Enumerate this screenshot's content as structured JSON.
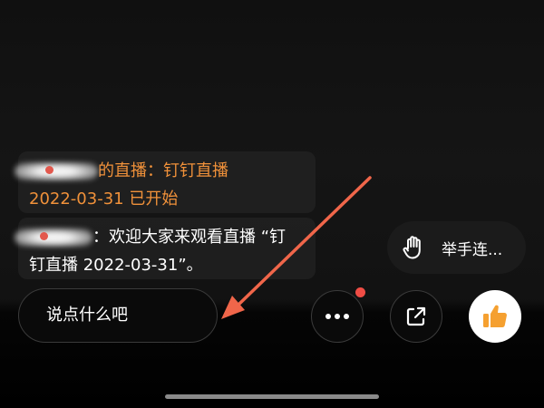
{
  "chat": {
    "system_message": {
      "line1_suffix": "的直播：钉钉直播",
      "line2": "2022-03-31 已开始"
    },
    "user_message": {
      "line1_suffix": "：欢迎大家来观看直播 “钉",
      "line2": "钉直播 2022-03-31”。"
    }
  },
  "raise_hand": {
    "label": "举手连...",
    "icon": "raise-hand-icon"
  },
  "input": {
    "placeholder": "说点什么吧"
  },
  "toolbar": {
    "more_icon": "ellipsis-icon",
    "share_icon": "share-icon",
    "like_icon": "thumbs-up-icon",
    "notification_dot": true
  },
  "colors": {
    "system_text": "#f0913a",
    "like_icon": "#f5a030",
    "notification_dot": "#f04d45",
    "annotation_arrow": "#f0664a"
  }
}
